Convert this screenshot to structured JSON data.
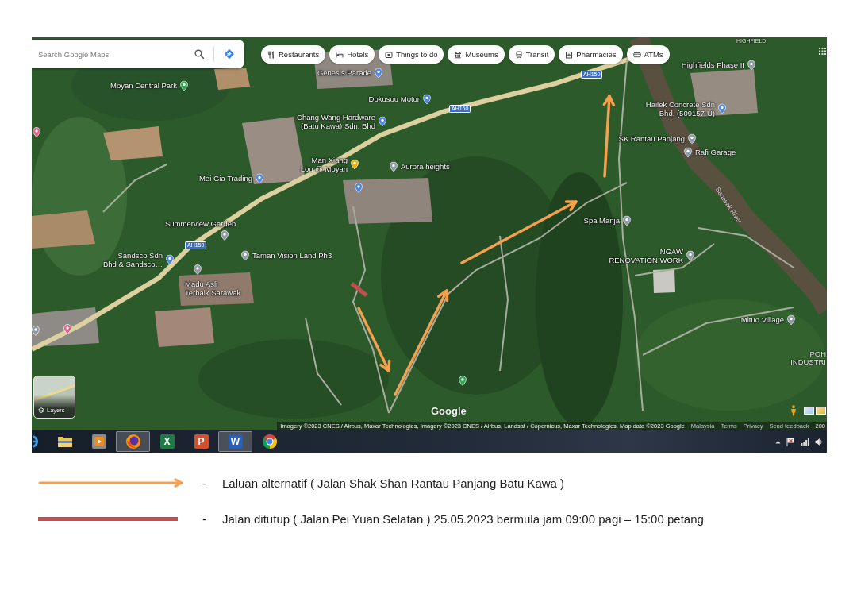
{
  "map": {
    "search": {
      "placeholder": "Search Google Maps"
    },
    "chips": [
      {
        "kind": "restaurants",
        "label": "Restaurants"
      },
      {
        "kind": "hotels",
        "label": "Hotels"
      },
      {
        "kind": "things",
        "label": "Things to do"
      },
      {
        "kind": "museums",
        "label": "Museums"
      },
      {
        "kind": "transit",
        "label": "Transit"
      },
      {
        "kind": "pharmacies",
        "label": "Pharmacies"
      },
      {
        "kind": "atms",
        "label": "ATMs"
      }
    ],
    "places": [
      {
        "name": "Highfields Phase II",
        "color": "#8f9aa6"
      },
      {
        "name": "Genesis Parade",
        "color": "#4a86e8"
      },
      {
        "name": "Moyan Central Park",
        "color": "#34a853"
      },
      {
        "name": "Dokusou Motor",
        "color": "#4a86e8"
      },
      {
        "name": "Hailek Concrete Sdn\nBhd. (509157-U)",
        "color": "#4a86e8"
      },
      {
        "name": "Chang Wang Hardware\n(Batu Kawa) Sdn. Bhd",
        "color": "#4a86e8"
      },
      {
        "name": "SK Rantau Panjang",
        "color": "#8f9aa6"
      },
      {
        "name": "Rafi Garage",
        "color": "#8f9aa6"
      },
      {
        "name": "Man Xiang\nLou @ Moyan",
        "color": "#f2b300"
      },
      {
        "name": "Aurora heights",
        "color": "#8f9aa6"
      },
      {
        "name": "Mei Gia Trading",
        "color": "#4a86e8"
      },
      {
        "name": "Summerview Garden",
        "color": "#8f9aa6"
      },
      {
        "name": "Spa Manja",
        "color": "#8f9aa6"
      },
      {
        "name": "Sandsco Sdn\nBhd & Sandsco…",
        "color": "#4a86e8"
      },
      {
        "name": "Taman Vision Land Ph3",
        "color": "#8f9aa6"
      },
      {
        "name": "NGAW\nRENOVATION WORK",
        "color": "#8f9aa6"
      },
      {
        "name": "Madu Asli\nTerbaik Sarawak",
        "color": "#8f9aa6"
      },
      {
        "name": "Mituo Village",
        "color": "#8f9aa6"
      }
    ],
    "pins": [
      {
        "color": "#e0608a"
      },
      {
        "color": "#4a86e8"
      },
      {
        "color": "#e0608a"
      },
      {
        "color": "#8f9aa6"
      },
      {
        "color": "#34a853"
      }
    ],
    "area_labels": [
      "HIGHFIELD",
      "POH\nINDUSTRI"
    ],
    "river_label": "Sarawak River",
    "road_shields": [
      "AH150",
      "AH150",
      "AH150"
    ],
    "layers_button": {
      "label": "Layers"
    },
    "logo": "Google",
    "attribution": "Imagery ©2023 CNES / Airbus, Maxar Technologies, Imagery ©2023 CNES / Airbus, Landsat / Copernicus, Maxar Technologies, Map data ©2023 Google",
    "footer_links": [
      "Malaysia",
      "Terms",
      "Privacy",
      "Send feedback"
    ],
    "scale": "200"
  },
  "taskbar": {
    "apps": [
      {
        "kind": "ie",
        "open": false
      },
      {
        "kind": "explorer",
        "open": false
      },
      {
        "kind": "media",
        "open": false
      },
      {
        "kind": "firefox",
        "open": true
      },
      {
        "kind": "excel",
        "glyph": "X",
        "open": false
      },
      {
        "kind": "powerpoint",
        "glyph": "P",
        "open": false
      },
      {
        "kind": "word",
        "glyph": "W",
        "open": true
      },
      {
        "kind": "chrome",
        "open": false
      }
    ]
  },
  "legend": [
    {
      "kind": "arrow",
      "color": "#f4a04e",
      "marker": "-",
      "text": "Laluan alternatif ( Jalan Shak Shan Rantau Panjang Batu Kawa )"
    },
    {
      "kind": "line",
      "color": "#c0504d",
      "marker": "-",
      "text": "Jalan ditutup ( Jalan Pei Yuan Selatan ) 25.05.2023 bermula jam 09:00 pagi – 15:00 petang"
    }
  ]
}
